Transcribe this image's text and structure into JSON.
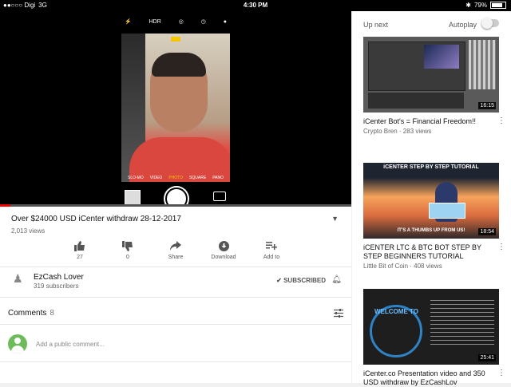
{
  "status_bar": {
    "carrier": "●●○○○ Digi",
    "network": "3G",
    "time": "4:30 PM",
    "battery": "79%"
  },
  "camera": {
    "top_icons": [
      "flash-icon",
      "hdr",
      "live-icon",
      "timer-icon",
      "filter-icon"
    ],
    "hdr_label": "HDR",
    "modes": [
      "SLO-MO",
      "VIDEO",
      "PHOTO",
      "SQUARE",
      "PANO"
    ],
    "active_mode": "PHOTO"
  },
  "video": {
    "title": "Over $24000 USD iCenter withdraw 28-12-2017",
    "views": "2,013 views",
    "progress": 0.03
  },
  "actions": [
    {
      "icon": "thumbs-up-icon",
      "label": "27"
    },
    {
      "icon": "thumbs-down-icon",
      "label": "0"
    },
    {
      "icon": "share-icon",
      "label": "Share"
    },
    {
      "icon": "download-icon",
      "label": "Download"
    },
    {
      "icon": "add-to-playlist-icon",
      "label": "Add to"
    }
  ],
  "channel": {
    "name": "EzCash Lover",
    "subscribers": "319 subscribers",
    "subscribed_label": "SUBSCRIBED"
  },
  "comments": {
    "label": "Comments",
    "count": "8",
    "placeholder": "Add a public comment..."
  },
  "upnext": {
    "header": "Up next",
    "autoplay_label": "Autoplay",
    "autoplay_on": false,
    "items": [
      {
        "title": "iCenter Bot's = Financial Freedom!!",
        "meta": "Crypto Bren · 283 views",
        "duration": "16:15"
      },
      {
        "title": "iCENTER LTC & BTC BOT STEP BY STEP BEGINNERS TUTORIAL",
        "meta": "Little Bit of Coin · 408 views",
        "duration": "18:54",
        "thumb_text_top": "iCENTER STEP BY STEP TUTORIAL",
        "thumb_text_bottom": "IT'S A THUMBS UP FROM US!"
      },
      {
        "title": "iCenter.co Presentation video and 350 USD withdraw by EzCashLov",
        "meta": "",
        "duration": "25:41",
        "thumb_text": "WELCOME TO"
      }
    ]
  }
}
